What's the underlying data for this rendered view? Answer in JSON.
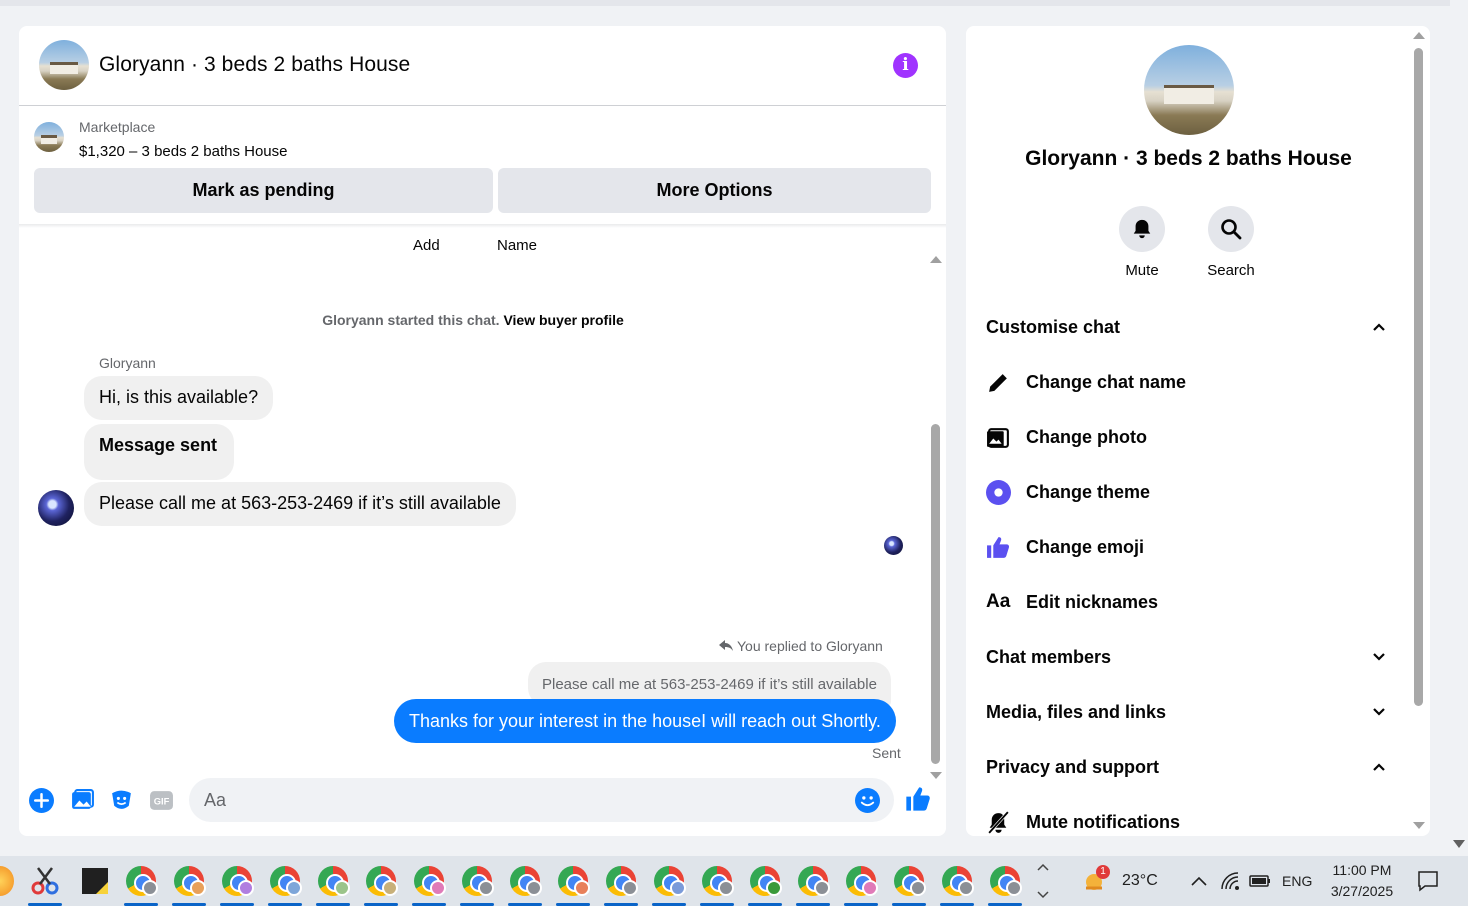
{
  "chat": {
    "title": "Gloryann · 3 beds 2 baths House",
    "marketplace_label": "Marketplace",
    "listing": "$1,320 – 3 beds 2 baths House",
    "pending_button": "Mark as pending",
    "more_button": "More Options",
    "top_actions": [
      "Add",
      "Name"
    ],
    "system_text": "Gloryann started this chat. ",
    "system_link": "View buyer profile",
    "sender_name": "Gloryann",
    "messages": [
      "Hi, is this available?",
      "Message sent",
      "Please call me at 563-253-2469 if it’s still available"
    ],
    "replied_label": "You replied to Gloryann",
    "quoted_text": "Please call me at 563-253-2469 if it’s still available",
    "my_message": "Thanks for your interest in the houseI will reach out Shortly.",
    "sent_status": "Sent",
    "composer_placeholder": "Aa"
  },
  "panel": {
    "title": "Gloryann · 3 beds 2 baths House",
    "mute_label": "Mute",
    "search_label": "Search",
    "customise_label": "Customise chat",
    "items": [
      "Change chat name",
      "Change photo",
      "Change theme",
      "Change emoji",
      "Edit nicknames"
    ],
    "chat_members": "Chat members",
    "media": "Media, files and links",
    "privacy": "Privacy and support",
    "mute_notifications": "Mute notifications",
    "theme_color": "#5b50f0",
    "accent": "#0a7cff"
  },
  "taskbar": {
    "temperature": "23°C",
    "language": "ENG",
    "time": "11:00 PM",
    "date": "3/27/2025",
    "weather_badge": "1"
  }
}
